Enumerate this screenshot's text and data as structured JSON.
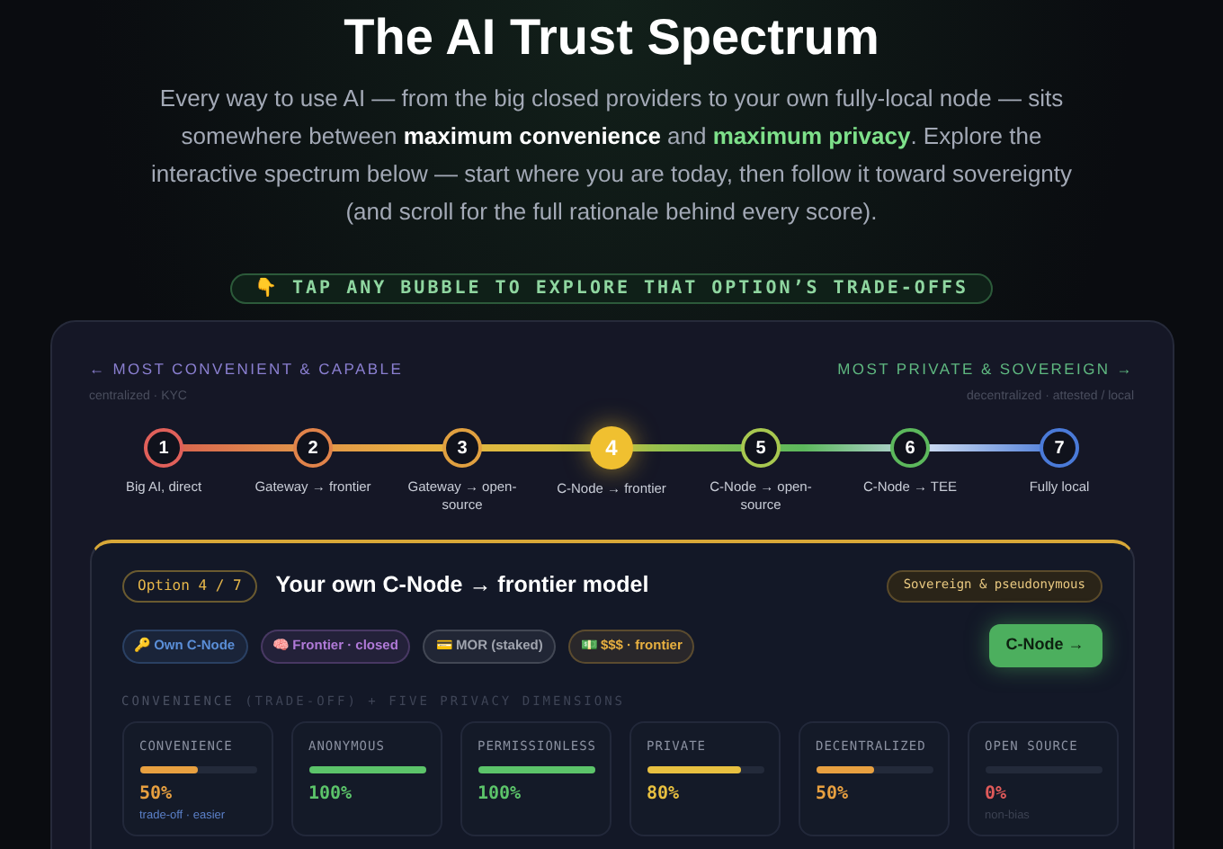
{
  "title": "The AI Trust Spectrum",
  "intro": "Every way to use AI — from the big closed providers to your own fully-local node — sits somewhere between **maximum convenience** and **maximum privacy**. Explore the interactive spectrum below — start where you are today, then follow it toward sovereignty (and scroll for the full rationale behind every score).",
  "hint": "👇 TAP ANY BUBBLE TO EXPLORE THAT OPTION’S TRADE-OFFS",
  "spectrum": {
    "left_label": "← MOST CONVENIENT & CAPABLE",
    "left_sub": "centralized · KYC",
    "right_label": "MOST PRIVATE & SOVEREIGN →",
    "right_sub": "decentralized · attested / local",
    "steps": [
      {
        "number": "1",
        "label": "Big AI, direct",
        "color": "#e0605a",
        "selected": false
      },
      {
        "number": "2",
        "label": "Gateway → frontier",
        "color": "#e0834a",
        "selected": false
      },
      {
        "number": "3",
        "label": "Gateway → open-source",
        "color": "#e0a040",
        "selected": false
      },
      {
        "number": "4",
        "label": "C-Node → frontier",
        "color": "#f0c030",
        "selected": true
      },
      {
        "number": "5",
        "label": "C-Node → open-source",
        "color": "#a8c850",
        "selected": false
      },
      {
        "number": "6",
        "label": "C-Node → TEE",
        "color": "#5cb85c",
        "selected": false
      },
      {
        "number": "7",
        "label": "Fully local",
        "color": "#4a7ad8",
        "selected": false
      }
    ]
  },
  "detail": {
    "option": "Option 4 / 7",
    "title": "Your own C-Node → frontier model",
    "badge": "Sovereign & pseudonymous",
    "chips": [
      {
        "text": "🔑 Own C-Node",
        "color": "#5b8fd8"
      },
      {
        "text": "🧠 Frontier · closed",
        "color": "#b07ad8"
      },
      {
        "text": "💳 MOR (staked)",
        "color": "#a0a4ae"
      },
      {
        "text": "💵 $$$ · frontier",
        "color": "#e8b040"
      }
    ],
    "button": "C-Node →",
    "section_label": "CONVENIENCE",
    "section_label_rest": "(TRADE-OFF) + FIVE PRIVACY DIMENSIONS",
    "metrics": [
      {
        "name": "CONVENIENCE",
        "level": 0.5,
        "value": "50%",
        "color": "#e8a040",
        "note": "trade-off · easier",
        "kind": "tradeoff"
      },
      {
        "name": "ANONYMOUS",
        "level": 1,
        "value": "100%",
        "color": "#5cc46a"
      },
      {
        "name": "PERMISSIONLESS",
        "level": 1,
        "value": "100%",
        "color": "#5cc46a"
      },
      {
        "name": "PRIVATE",
        "level": 0.8,
        "value": "80%",
        "color": "#e8c040"
      },
      {
        "name": "DECENTRALIZED",
        "level": 0.5,
        "value": "50%",
        "color": "#e8a040"
      },
      {
        "name": "OPEN SOURCE",
        "level": 0,
        "value": "0%",
        "color": "#e05a5a",
        "note": "non-bias",
        "kind": "plain"
      }
    ]
  }
}
